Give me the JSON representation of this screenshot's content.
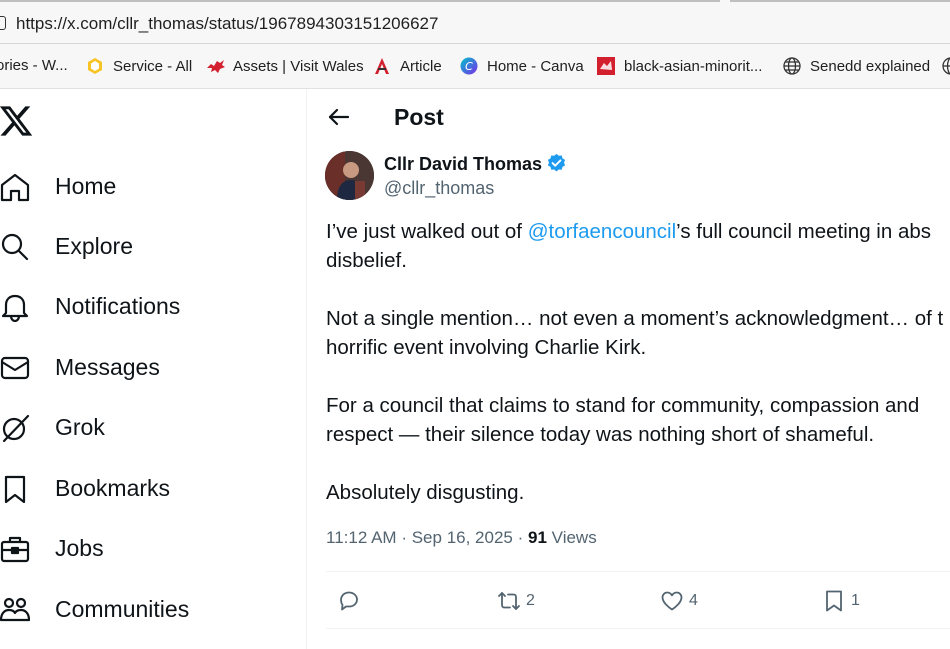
{
  "browser": {
    "url": "https://x.com/cllr_thomas/status/1967894303151206627",
    "bookmarks": [
      "ories - W...",
      "Service - All",
      "Assets | Visit Wales",
      "Article",
      "Home - Canva",
      "black-asian-minorit...",
      "Senedd explained"
    ]
  },
  "nav": {
    "items": [
      {
        "label": "Home",
        "icon": "home-icon"
      },
      {
        "label": "Explore",
        "icon": "search-icon"
      },
      {
        "label": "Notifications",
        "icon": "bell-icon"
      },
      {
        "label": "Messages",
        "icon": "envelope-icon"
      },
      {
        "label": "Grok",
        "icon": "grok-icon"
      },
      {
        "label": "Bookmarks",
        "icon": "bookmark-icon"
      },
      {
        "label": "Jobs",
        "icon": "briefcase-icon"
      },
      {
        "label": "Communities",
        "icon": "people-icon"
      }
    ]
  },
  "post": {
    "header_title": "Post",
    "author": {
      "name": "Cllr David Thomas",
      "handle": "@cllr_thomas",
      "verified": true
    },
    "text": {
      "p1_before": "I’ve just walked out of ",
      "p1_mention": "@torfaencouncil",
      "p1_after": "’s full council meeting in abs",
      "p1_line2": "disbelief.",
      "p2_line1": "Not a single mention… not even a moment’s acknowledgment… of t",
      "p2_line2": "horrific event involving Charlie Kirk.",
      "p3_line1": "For a council that claims to stand for community, compassion and",
      "p3_line2": "respect — their silence today was nothing short of shameful.",
      "p4_line1": "Absolutely disgusting."
    },
    "meta": {
      "time": "11:12 AM",
      "date": "Sep 16, 2025",
      "dot": "·",
      "views_count": "91",
      "views_label": "Views"
    },
    "actions": {
      "reply_count": "",
      "repost_count": "2",
      "like_count": "4",
      "bookmark_count": "1"
    }
  },
  "colors": {
    "accent": "#1d9bf0",
    "text": "#0f1419",
    "muted": "#536471"
  }
}
